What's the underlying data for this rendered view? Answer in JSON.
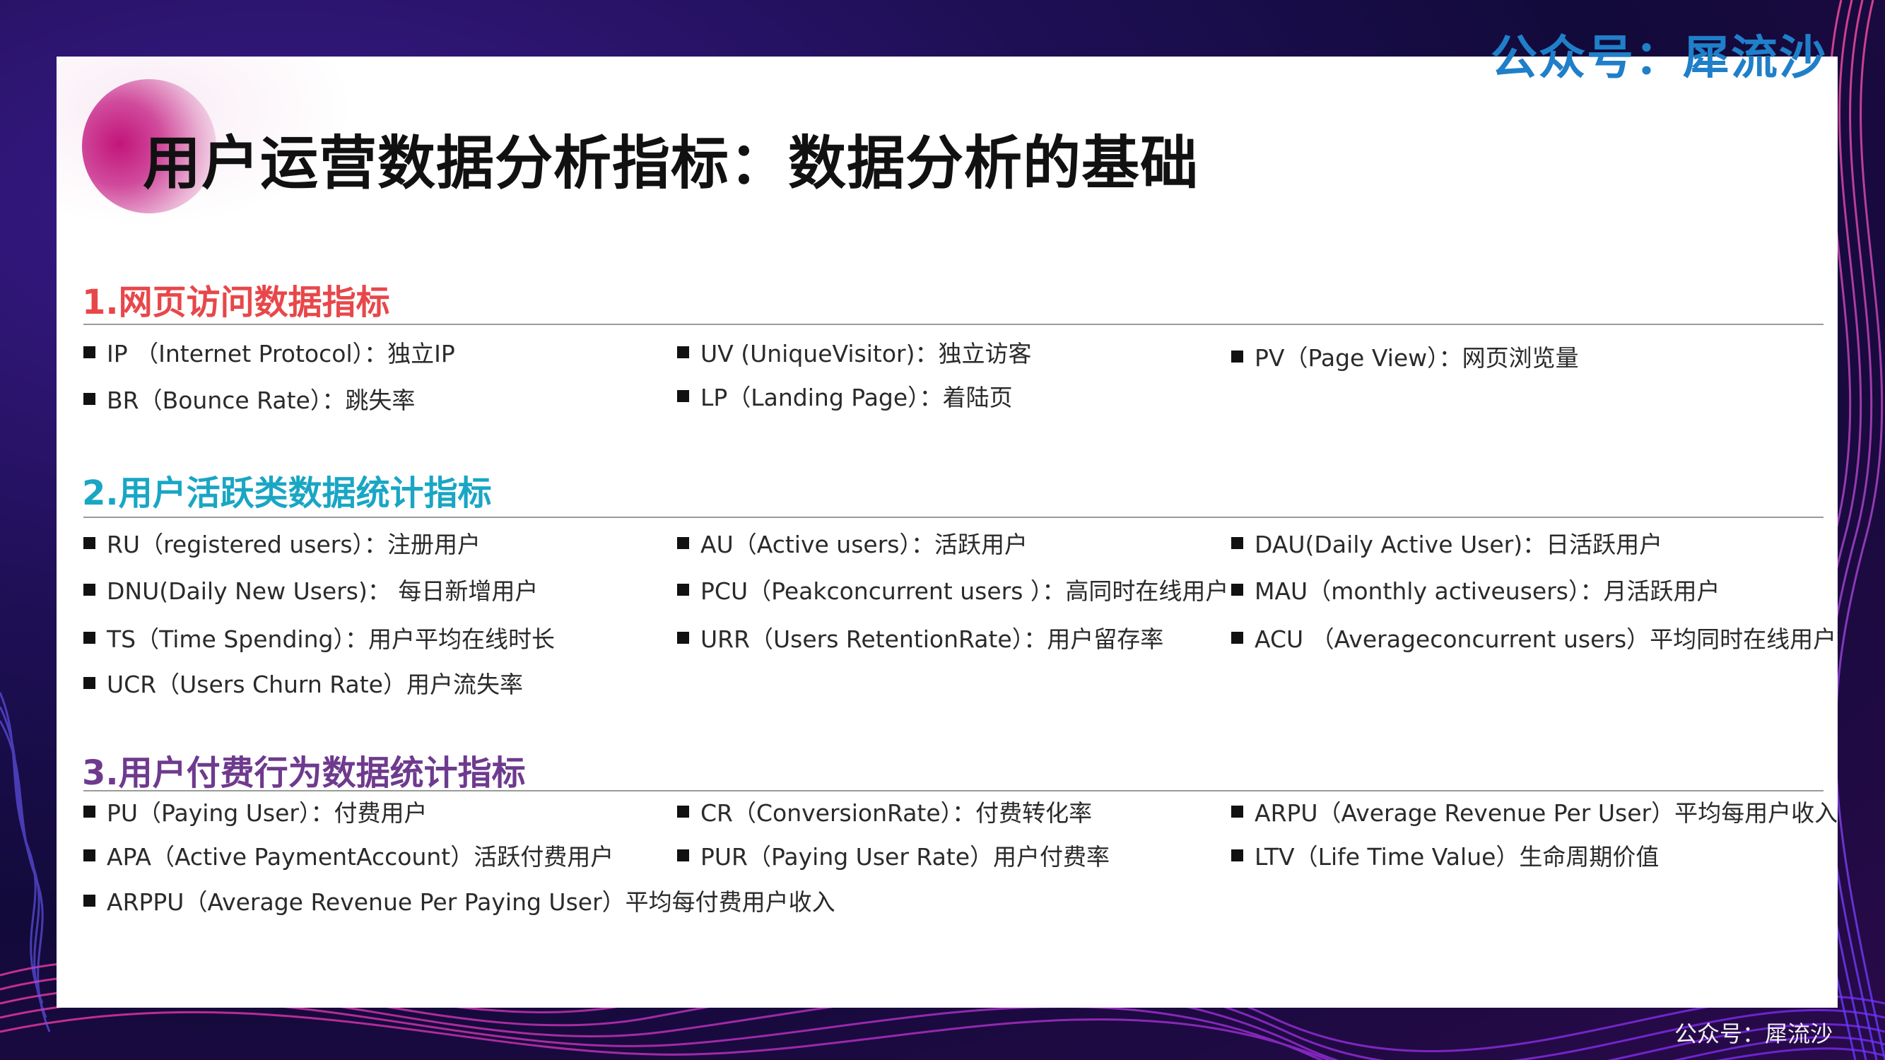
{
  "watermark_top": "公众号：犀流沙",
  "watermark_bottom": "公众号：犀流沙",
  "title": "用户运营数据分析指标：数据分析的基础",
  "colors": {
    "section1": "#e8474a",
    "section2": "#19a6c4",
    "section3": "#6e3a8e",
    "watermark": "#1f7fc9"
  },
  "sections": [
    {
      "title": "1.网页访问数据指标",
      "items": [
        "IP （Internet Protocol）：独立IP",
        "UV (UniqueVisitor)：独立访客",
        "PV（Page View）：网页浏览量",
        "BR（Bounce Rate）：跳失率",
        "LP（Landing Page）：着陆页"
      ]
    },
    {
      "title": "2.用户活跃类数据统计指标",
      "items": [
        "RU（registered users）：注册用户",
        "AU（Active users）：活跃用户",
        "DAU(Daily Active User)：日活跃用户",
        "DNU(Daily New Users)： 每日新增用户",
        "PCU（Peakconcurrent users ）：高同时在线用户",
        "MAU（monthly activeusers）：月活跃用户",
        "TS（Time Spending）：用户平均在线时长",
        "URR（Users RetentionRate）：用户留存率",
        "ACU （Averageconcurrent users）平均同时在线用户数",
        "UCR（Users Churn Rate）用户流失率"
      ]
    },
    {
      "title": "3.用户付费行为数据统计指标",
      "items": [
        "PU（Paying User）：付费用户",
        "CR（ConversionRate）：付费转化率",
        "ARPU（Average Revenue Per User）平均每用户收入",
        "APA（Active PaymentAccount）活跃付费用户",
        "PUR（Paying User Rate）用户付费率",
        "LTV（Life Time Value）生命周期价值",
        "ARPPU（Average Revenue Per Paying User）平均每付费用户收入"
      ]
    }
  ]
}
